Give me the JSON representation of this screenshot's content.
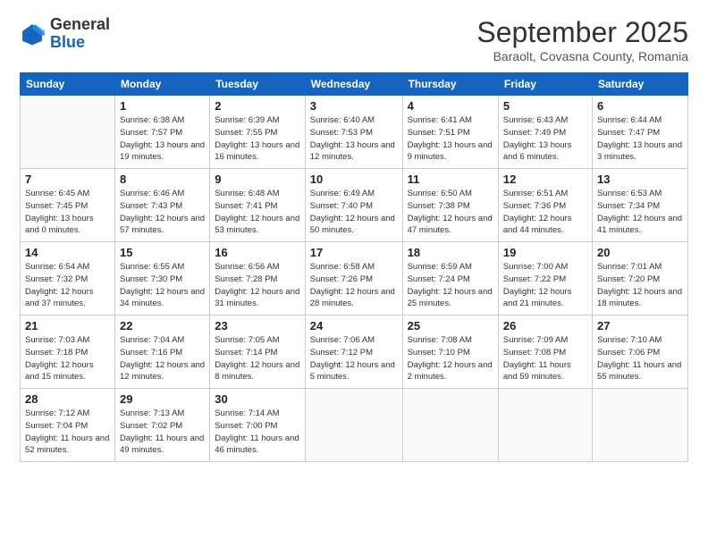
{
  "header": {
    "logo": {
      "general": "General",
      "blue": "Blue"
    },
    "title": "September 2025",
    "subtitle": "Baraolt, Covasna County, Romania"
  },
  "calendar": {
    "days": [
      "Sunday",
      "Monday",
      "Tuesday",
      "Wednesday",
      "Thursday",
      "Friday",
      "Saturday"
    ],
    "weeks": [
      [
        {
          "day": null
        },
        {
          "day": 1,
          "sunrise": "6:38 AM",
          "sunset": "7:57 PM",
          "daylight": "13 hours and 19 minutes."
        },
        {
          "day": 2,
          "sunrise": "6:39 AM",
          "sunset": "7:55 PM",
          "daylight": "13 hours and 16 minutes."
        },
        {
          "day": 3,
          "sunrise": "6:40 AM",
          "sunset": "7:53 PM",
          "daylight": "13 hours and 12 minutes."
        },
        {
          "day": 4,
          "sunrise": "6:41 AM",
          "sunset": "7:51 PM",
          "daylight": "13 hours and 9 minutes."
        },
        {
          "day": 5,
          "sunrise": "6:43 AM",
          "sunset": "7:49 PM",
          "daylight": "13 hours and 6 minutes."
        },
        {
          "day": 6,
          "sunrise": "6:44 AM",
          "sunset": "7:47 PM",
          "daylight": "13 hours and 3 minutes."
        }
      ],
      [
        {
          "day": 7,
          "sunrise": "6:45 AM",
          "sunset": "7:45 PM",
          "daylight": "13 hours and 0 minutes."
        },
        {
          "day": 8,
          "sunrise": "6:46 AM",
          "sunset": "7:43 PM",
          "daylight": "12 hours and 57 minutes."
        },
        {
          "day": 9,
          "sunrise": "6:48 AM",
          "sunset": "7:41 PM",
          "daylight": "12 hours and 53 minutes."
        },
        {
          "day": 10,
          "sunrise": "6:49 AM",
          "sunset": "7:40 PM",
          "daylight": "12 hours and 50 minutes."
        },
        {
          "day": 11,
          "sunrise": "6:50 AM",
          "sunset": "7:38 PM",
          "daylight": "12 hours and 47 minutes."
        },
        {
          "day": 12,
          "sunrise": "6:51 AM",
          "sunset": "7:36 PM",
          "daylight": "12 hours and 44 minutes."
        },
        {
          "day": 13,
          "sunrise": "6:53 AM",
          "sunset": "7:34 PM",
          "daylight": "12 hours and 41 minutes."
        }
      ],
      [
        {
          "day": 14,
          "sunrise": "6:54 AM",
          "sunset": "7:32 PM",
          "daylight": "12 hours and 37 minutes."
        },
        {
          "day": 15,
          "sunrise": "6:55 AM",
          "sunset": "7:30 PM",
          "daylight": "12 hours and 34 minutes."
        },
        {
          "day": 16,
          "sunrise": "6:56 AM",
          "sunset": "7:28 PM",
          "daylight": "12 hours and 31 minutes."
        },
        {
          "day": 17,
          "sunrise": "6:58 AM",
          "sunset": "7:26 PM",
          "daylight": "12 hours and 28 minutes."
        },
        {
          "day": 18,
          "sunrise": "6:59 AM",
          "sunset": "7:24 PM",
          "daylight": "12 hours and 25 minutes."
        },
        {
          "day": 19,
          "sunrise": "7:00 AM",
          "sunset": "7:22 PM",
          "daylight": "12 hours and 21 minutes."
        },
        {
          "day": 20,
          "sunrise": "7:01 AM",
          "sunset": "7:20 PM",
          "daylight": "12 hours and 18 minutes."
        }
      ],
      [
        {
          "day": 21,
          "sunrise": "7:03 AM",
          "sunset": "7:18 PM",
          "daylight": "12 hours and 15 minutes."
        },
        {
          "day": 22,
          "sunrise": "7:04 AM",
          "sunset": "7:16 PM",
          "daylight": "12 hours and 12 minutes."
        },
        {
          "day": 23,
          "sunrise": "7:05 AM",
          "sunset": "7:14 PM",
          "daylight": "12 hours and 8 minutes."
        },
        {
          "day": 24,
          "sunrise": "7:06 AM",
          "sunset": "7:12 PM",
          "daylight": "12 hours and 5 minutes."
        },
        {
          "day": 25,
          "sunrise": "7:08 AM",
          "sunset": "7:10 PM",
          "daylight": "12 hours and 2 minutes."
        },
        {
          "day": 26,
          "sunrise": "7:09 AM",
          "sunset": "7:08 PM",
          "daylight": "11 hours and 59 minutes."
        },
        {
          "day": 27,
          "sunrise": "7:10 AM",
          "sunset": "7:06 PM",
          "daylight": "11 hours and 55 minutes."
        }
      ],
      [
        {
          "day": 28,
          "sunrise": "7:12 AM",
          "sunset": "7:04 PM",
          "daylight": "11 hours and 52 minutes."
        },
        {
          "day": 29,
          "sunrise": "7:13 AM",
          "sunset": "7:02 PM",
          "daylight": "11 hours and 49 minutes."
        },
        {
          "day": 30,
          "sunrise": "7:14 AM",
          "sunset": "7:00 PM",
          "daylight": "11 hours and 46 minutes."
        },
        {
          "day": null
        },
        {
          "day": null
        },
        {
          "day": null
        },
        {
          "day": null
        }
      ]
    ]
  }
}
